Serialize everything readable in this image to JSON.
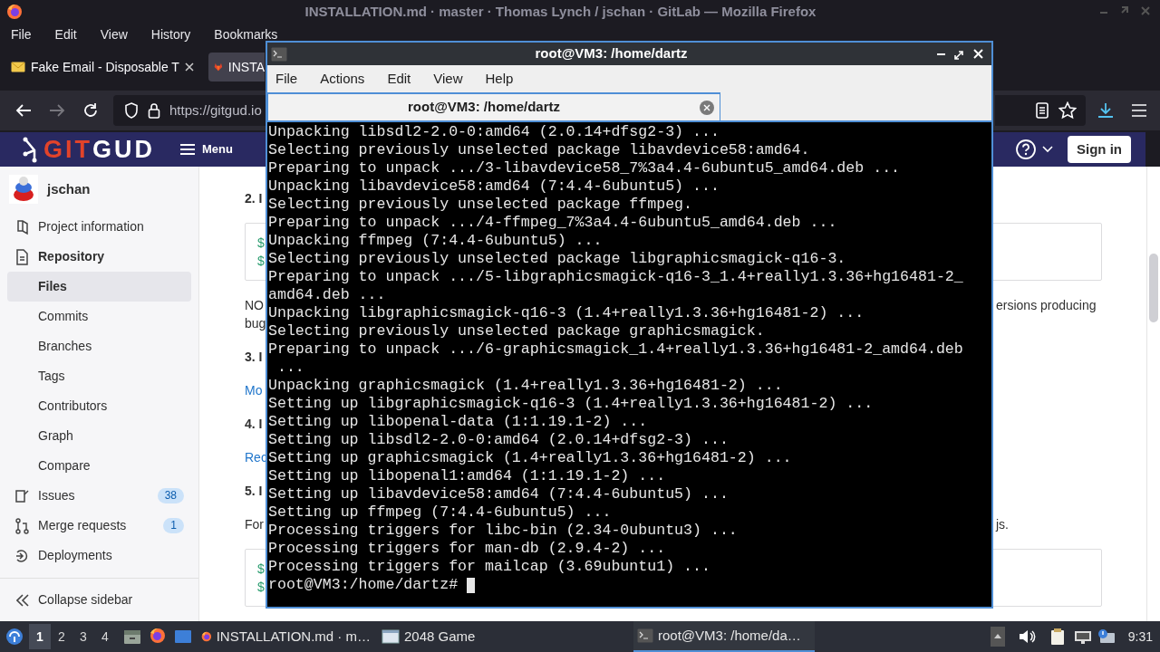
{
  "firefox": {
    "title": "INSTALLATION.md · master · Thomas Lynch / jschan · GitLab — Mozilla Firefox",
    "menu": [
      "File",
      "Edit",
      "View",
      "History",
      "Bookmarks"
    ],
    "tabs": [
      {
        "label": "Fake Email - Disposable T",
        "selected": false
      },
      {
        "label": "INSTA",
        "selected": true
      }
    ],
    "url": "https://gitgud.io"
  },
  "gitlab": {
    "logo": [
      "GIT",
      "GUD"
    ],
    "menu_button": "Menu",
    "sign_in": "Sign in",
    "sidebar": {
      "project": "jschan",
      "items": [
        {
          "kind": "section",
          "label": "Project information",
          "selected": false,
          "active": false
        },
        {
          "kind": "section",
          "label": "Repository",
          "selected": false,
          "active": true
        },
        {
          "kind": "sub",
          "label": "Files",
          "selected": true,
          "active": true
        },
        {
          "kind": "sub",
          "label": "Commits",
          "selected": false,
          "active": false
        },
        {
          "kind": "sub",
          "label": "Branches",
          "selected": false,
          "active": false
        },
        {
          "kind": "sub",
          "label": "Tags",
          "selected": false,
          "active": false
        },
        {
          "kind": "sub",
          "label": "Contributors",
          "selected": false,
          "active": false
        },
        {
          "kind": "sub",
          "label": "Graph",
          "selected": false,
          "active": false
        },
        {
          "kind": "sub",
          "label": "Compare",
          "selected": false,
          "active": false
        },
        {
          "kind": "section",
          "label": "Issues",
          "badge": "38",
          "selected": false,
          "active": false
        },
        {
          "kind": "section",
          "label": "Merge requests",
          "badge": "1",
          "selected": false,
          "active": false
        },
        {
          "kind": "section",
          "label": "Deployments",
          "selected": false,
          "active": false
        }
      ],
      "collapse": "Collapse sidebar"
    },
    "content": [
      {
        "kind": "heading",
        "text": "2. I"
      },
      {
        "kind": "code",
        "lines": [
          "$",
          "$"
        ]
      },
      {
        "kind": "paragraph",
        "lines": [
          {
            "left": "NO",
            "right": "ersions producing"
          },
          {
            "left": "bug"
          }
        ]
      },
      {
        "kind": "heading",
        "text": "3. I"
      },
      {
        "kind": "link",
        "text": "Mo"
      },
      {
        "kind": "heading",
        "text": "4. I"
      },
      {
        "kind": "link",
        "text": "Rec"
      },
      {
        "kind": "heading",
        "text": "5. I"
      },
      {
        "kind": "paragraph",
        "lines": [
          {
            "left": "For",
            "right": "js."
          }
        ]
      },
      {
        "kind": "code",
        "lines": [
          "$",
          "$"
        ]
      }
    ]
  },
  "terminal": {
    "title": "root@VM3: /home/dartz",
    "menu": [
      "File",
      "Actions",
      "Edit",
      "View",
      "Help"
    ],
    "tab": "root@VM3: /home/dartz",
    "lines": [
      "Unpacking libsdl2-2.0-0:amd64 (2.0.14+dfsg2-3) ...",
      "Selecting previously unselected package libavdevice58:amd64.",
      "Preparing to unpack .../3-libavdevice58_7%3a4.4-6ubuntu5_amd64.deb ...",
      "Unpacking libavdevice58:amd64 (7:4.4-6ubuntu5) ...",
      "Selecting previously unselected package ffmpeg.",
      "Preparing to unpack .../4-ffmpeg_7%3a4.4-6ubuntu5_amd64.deb ...",
      "Unpacking ffmpeg (7:4.4-6ubuntu5) ...",
      "Selecting previously unselected package libgraphicsmagick-q16-3.",
      "Preparing to unpack .../5-libgraphicsmagick-q16-3_1.4+really1.3.36+hg16481-2_",
      "amd64.deb ...",
      "Unpacking libgraphicsmagick-q16-3 (1.4+really1.3.36+hg16481-2) ...",
      "Selecting previously unselected package graphicsmagick.",
      "Preparing to unpack .../6-graphicsmagick_1.4+really1.3.36+hg16481-2_amd64.deb",
      " ...",
      "Unpacking graphicsmagick (1.4+really1.3.36+hg16481-2) ...",
      "Setting up libgraphicsmagick-q16-3 (1.4+really1.3.36+hg16481-2) ...",
      "Setting up libopenal-data (1:1.19.1-2) ...",
      "Setting up libsdl2-2.0-0:amd64 (2.0.14+dfsg2-3) ...",
      "Setting up graphicsmagick (1.4+really1.3.36+hg16481-2) ...",
      "Setting up libopenal1:amd64 (1:1.19.1-2) ...",
      "Setting up libavdevice58:amd64 (7:4.4-6ubuntu5) ...",
      "Setting up ffmpeg (7:4.4-6ubuntu5) ...",
      "Processing triggers for libc-bin (2.34-0ubuntu3) ...",
      "Processing triggers for man-db (2.9.4-2) ...",
      "Processing triggers for mailcap (3.69ubuntu1) ..."
    ],
    "prompt": "root@VM3:/home/dartz# "
  },
  "taskbar": {
    "workspaces": [
      {
        "label": "1",
        "selected": true
      },
      {
        "label": "2",
        "selected": false
      },
      {
        "label": "3",
        "selected": false
      },
      {
        "label": "4",
        "selected": false
      }
    ],
    "tasks": [
      {
        "kind": "browser",
        "label": "INSTALLATION.md · m…",
        "selected": false
      },
      {
        "kind": "window",
        "label": "2048 Game",
        "selected": false
      },
      {
        "kind": "terminal",
        "label": "root@VM3: /home/da…",
        "selected": true
      }
    ],
    "clock": "9:31"
  }
}
